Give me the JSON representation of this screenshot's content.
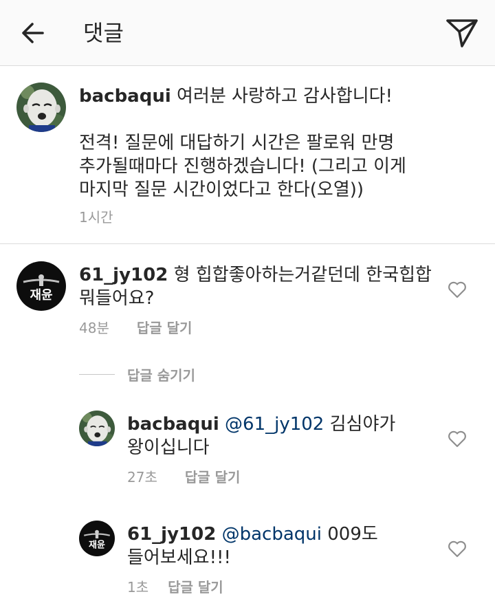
{
  "header": {
    "title": "댓글",
    "back_icon": "arrow-left-icon",
    "send_icon": "paper-plane-icon"
  },
  "caption": {
    "username": "bacbaqui",
    "text": "여러분 사랑하고 감사합니다!\n\n전격! 질문에 대답하기 시간은 팔로워 만명\n추가될때마다 진행하겠습니다! (그리고 이게\n마지막 질문 시간이었다고 한다(오열))",
    "time": "1시간"
  },
  "comments": [
    {
      "username": "61_jy102",
      "text": "형 힙합좋아하는거같던데 한국힙합\n뭐들어요?",
      "time": "48분",
      "reply_label": "답글 달기",
      "avatar_text": "재윤"
    }
  ],
  "replies_toggle": "답글 숨기기",
  "replies": [
    {
      "username": "bacbaqui",
      "mention": "@61_jy102",
      "text": "김심야가\n왕이십니다",
      "time": "27초",
      "reply_label": "답글 달기"
    },
    {
      "username": "61_jy102",
      "mention": "@bacbaqui",
      "text": "009도\n들어보세요!!!",
      "time": "1초",
      "reply_label": "답글 달기",
      "avatar_text": "재윤"
    }
  ],
  "colors": {
    "text": "#262626",
    "mention": "#003569",
    "meta": "#999999",
    "divider": "#dbdbdb",
    "header_bg": "#fafafa"
  }
}
